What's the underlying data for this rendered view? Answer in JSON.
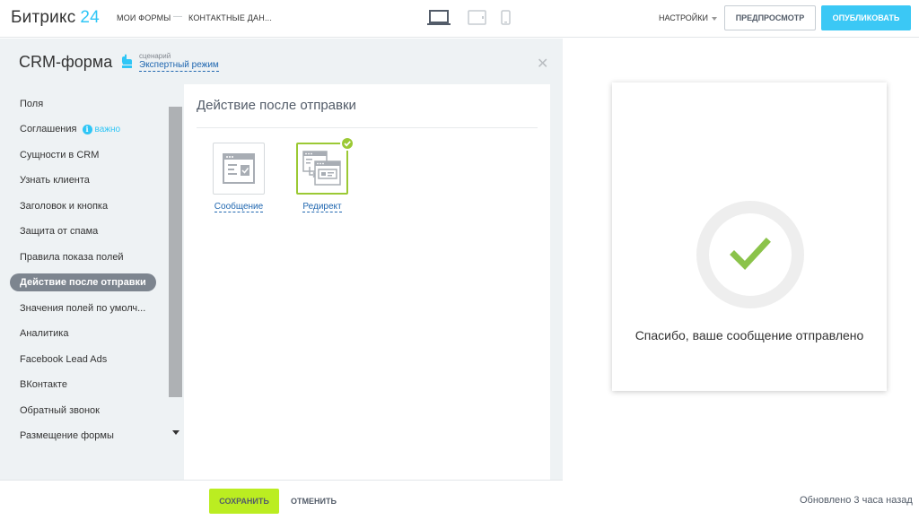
{
  "header": {
    "logo_text": "Битрикс",
    "logo_num": "24",
    "breadcrumb": [
      "МОИ ФОРМЫ",
      "КОНТАКТНЫЕ ДАН..."
    ],
    "breadcrumb_sep": "—",
    "devices": [
      "laptop-icon",
      "tablet-icon",
      "phone-icon"
    ],
    "settings_label": "НАСТРОЙКИ",
    "preview_label": "ПРЕДПРОСМОТР",
    "publish_label": "ОПУБЛИКОВАТЬ"
  },
  "panel": {
    "title": "CRM-форма",
    "scenario_small": "сценарий",
    "scenario_link": "Экспертный режим"
  },
  "nav": {
    "items": [
      {
        "label": "Поля"
      },
      {
        "label": "Соглашения",
        "badge": "важно"
      },
      {
        "label": "Сущности в CRM"
      },
      {
        "label": "Узнать клиента"
      },
      {
        "label": "Заголовок и кнопка"
      },
      {
        "label": "Защита от спама"
      },
      {
        "label": "Правила показа полей"
      },
      {
        "label": "Действие после отправки",
        "active": true
      },
      {
        "label": "Значения полей по умолч..."
      },
      {
        "label": "Аналитика"
      },
      {
        "label": "Facebook Lead Ads"
      },
      {
        "label": "ВКонтакте"
      },
      {
        "label": "Обратный звонок"
      },
      {
        "label": "Размещение формы"
      }
    ]
  },
  "content": {
    "title": "Действие после отправки",
    "options": [
      {
        "label": "Сообщение",
        "icon": "message-window-icon",
        "selected": false
      },
      {
        "label": "Редирект",
        "icon": "redirect-windows-icon",
        "selected": true
      }
    ]
  },
  "footer": {
    "save_label": "СОХРАНИТЬ",
    "cancel_label": "ОТМЕНИТЬ"
  },
  "preview": {
    "success_text": "Спасибо, ваше сообщение отправлено",
    "updated_text": "Обновлено 3 часа назад"
  },
  "colors": {
    "accent_blue": "#3bc8f5",
    "link_blue": "#2067b0",
    "save_green": "#bbed21",
    "check_green": "#9bc934",
    "active_nav": "#7d858f"
  }
}
